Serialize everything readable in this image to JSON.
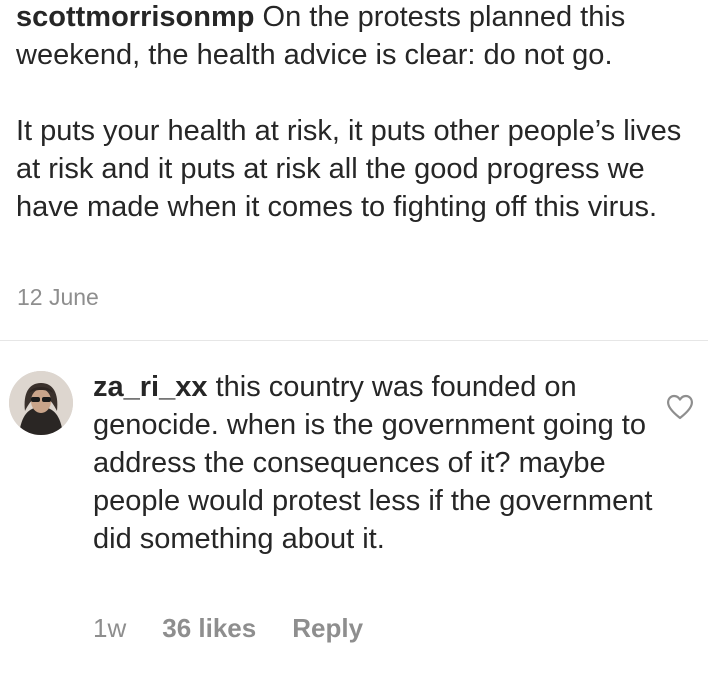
{
  "post": {
    "username": "scottmorrisonmp",
    "caption_line1": "On the protests planned this weekend, the health advice is clear: do not go.",
    "caption_line2": "It puts your health at risk, it puts other people’s lives at risk and it puts at risk all the good progress we have made when it comes to fighting off this virus.",
    "date": "12 June"
  },
  "comment": {
    "username": "za_ri_xx",
    "text": "this country was founded on genocide. when is the government going to address the consequences of it? maybe people would protest less if the government did something about it.",
    "time": "1w",
    "likes": "36 likes",
    "reply_label": "Reply",
    "like_icon": "heart-outline-icon"
  },
  "colors": {
    "text": "#262626",
    "secondary": "#8e8e8e",
    "divider": "#e6e6e6"
  }
}
